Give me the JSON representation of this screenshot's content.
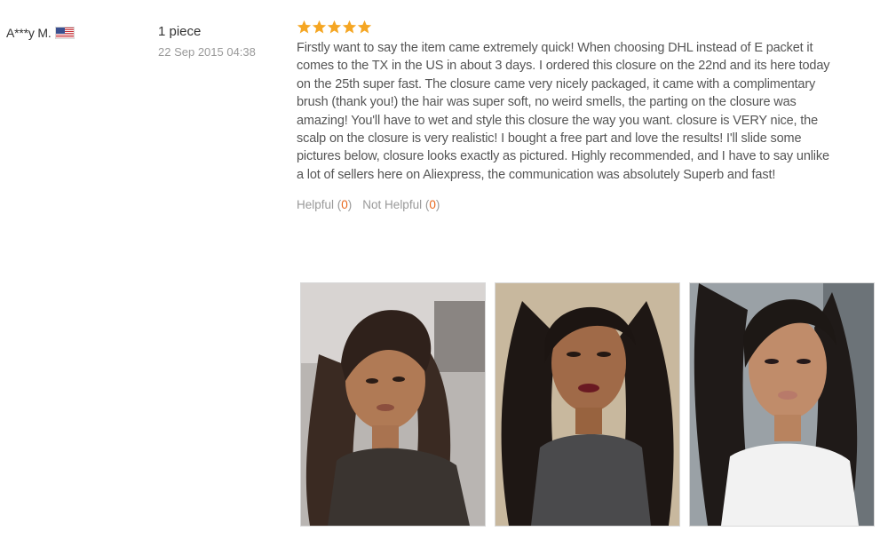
{
  "reviewer": {
    "name": "A***y M.",
    "country_flag_icon": "us-flag-icon"
  },
  "order": {
    "quantity": "1 piece",
    "date": "22 Sep 2015 04:38"
  },
  "rating": {
    "stars": 5,
    "max": 5,
    "color": "#f5a623"
  },
  "review": {
    "text": "Firstly want to say the item came extremely quick! When choosing DHL instead of E packet it comes to the TX in the US in about 3 days. I ordered this closure on the 22nd and its here today on the 25th super fast. The closure came very nicely packaged, it came with a complimentary brush (thank you!) the hair was super soft, no weird smells, the parting on the closure was amazing! You'll have to wet and style this closure the way you want. closure is VERY nice, the scalp on the closure is very realistic! I bought a free part and love the results! I'll slide some pictures below, closure looks exactly as pictured. Highly recommended, and I have to say unlike a lot of sellers here on Aliexpress, the communication was absolutely Superb and fast!"
  },
  "feedback": {
    "helpful_label": "Helpful",
    "helpful_count": "0",
    "not_helpful_label": "Not Helpful",
    "not_helpful_count": "0",
    "count_color": "#e8671c"
  },
  "photos": [
    {
      "name": "review-photo-1"
    },
    {
      "name": "review-photo-2"
    },
    {
      "name": "review-photo-3"
    }
  ]
}
